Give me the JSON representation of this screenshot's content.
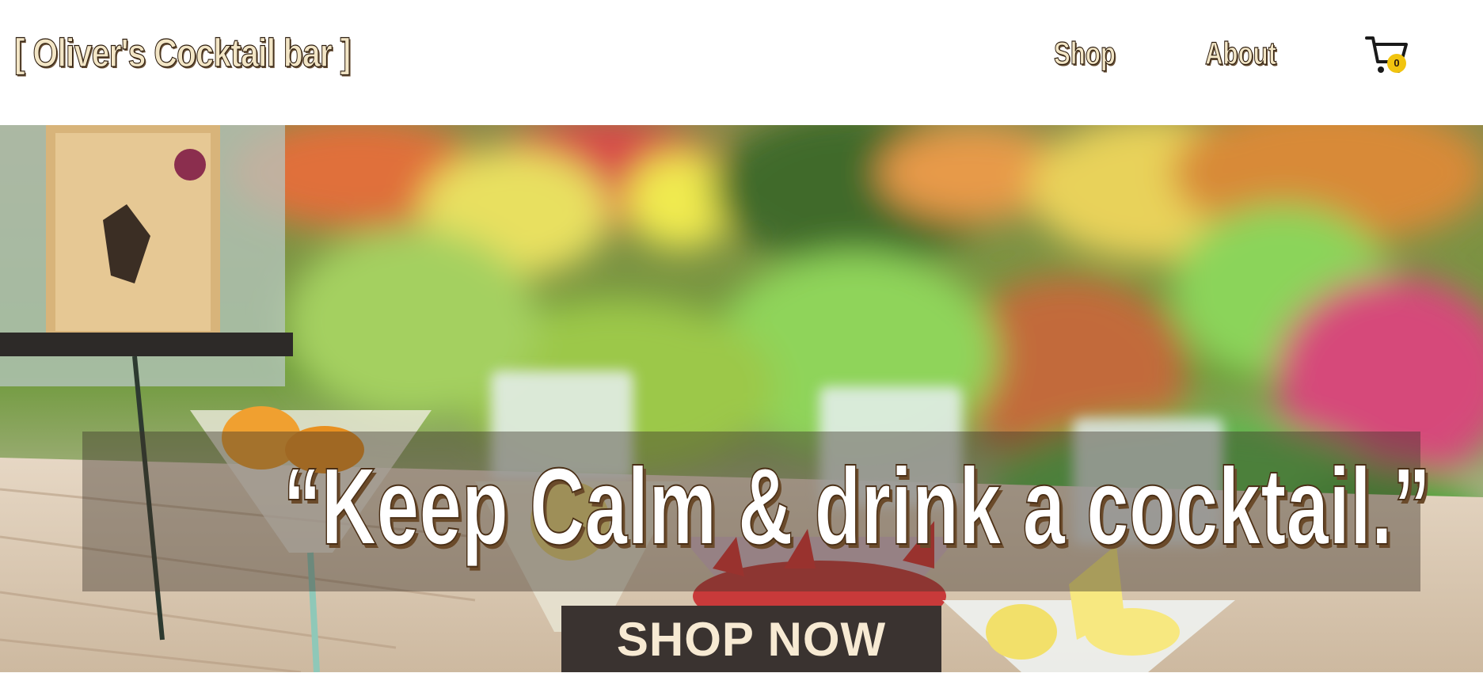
{
  "header": {
    "logo": "[ Oliver's Cocktail bar ]",
    "nav": {
      "shop": "Shop",
      "about": "About"
    },
    "cart": {
      "icon": "cart-icon",
      "count": "0"
    }
  },
  "hero": {
    "quote": "“Keep Calm & drink a cocktail.”",
    "cta": "SHOP NOW"
  },
  "colors": {
    "logo_fill": "#f3e6c6",
    "badge": "#f1c40f",
    "cta_bg": "#3a3330"
  }
}
